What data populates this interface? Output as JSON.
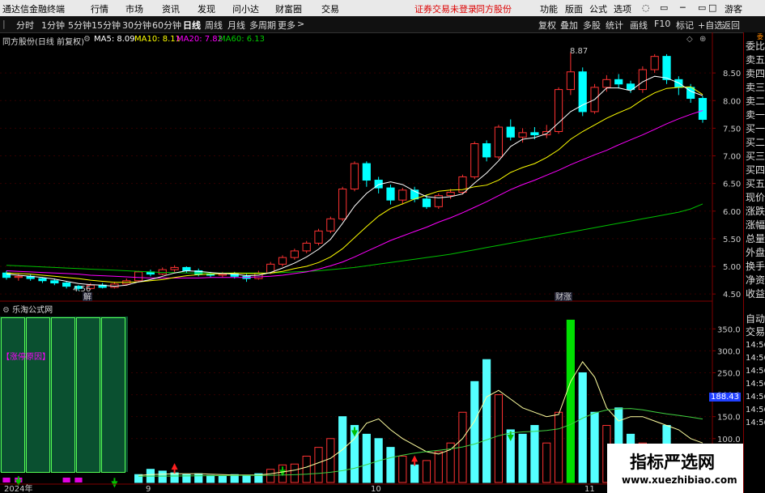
{
  "menubar": {
    "app_title": "通达信金融终端",
    "items": [
      "行情",
      "市场",
      "资讯",
      "发现",
      "问小达",
      "财富圈",
      "交易"
    ],
    "notice": "证券交易未登录",
    "stock": "同方股份",
    "right_items": [
      "功能",
      "版面",
      "公式",
      "选项"
    ],
    "guest": "游客"
  },
  "toolbar": {
    "periods": [
      "分时",
      "1分钟",
      "5分钟",
      "15分钟",
      "30分钟",
      "60分钟",
      "日线",
      "周线",
      "月线",
      "多周期",
      "更多"
    ],
    "active_period": "日线",
    "right_buttons": [
      "复权",
      "叠加",
      "多股",
      "统计",
      "画线",
      "F10",
      "标记",
      "+自选",
      "返回"
    ]
  },
  "infobar": {
    "title": "同方股份(日线 前复权)",
    "ma5": "MA5: 8.09",
    "ma10": "MA10: 8.11",
    "ma20": "MA20: 7.82",
    "ma60": "MA60: 6.13"
  },
  "lower_panel": {
    "title": "乐淘公式网",
    "label": "【涨停原因】"
  },
  "markers": {
    "high_label": "8.87",
    "low_label": "4.56",
    "tag_jie": "解",
    "tag_caizhang": "财涨"
  },
  "right_panel_items": [
    "委比",
    "卖五",
    "卖四",
    "卖三",
    "卖二",
    "卖一",
    "买一",
    "买二",
    "买三",
    "买四",
    "买五",
    "现价",
    "涨跌",
    "涨幅",
    "总量",
    "外盘",
    "换手",
    "净资",
    "收益",
    "自动",
    "交易",
    "14:56",
    "14:56",
    "14:56",
    "14:56",
    "14:56",
    "14:56",
    "14:56"
  ],
  "x_axis_labels": [
    "2024年",
    "9",
    "10",
    "11"
  ],
  "watermark": {
    "title": "指标严选网",
    "url": "www.xuezhibiao.com"
  },
  "colors": {
    "up": "#ff3232",
    "down": "#00ffff",
    "ma5": "#ffffff",
    "ma10": "#ffff00",
    "ma20": "#ff00ff",
    "ma60": "#00c000",
    "volume_up": "#ff3232",
    "volume_down": "#54ffff"
  },
  "chart_data": [
    {
      "type": "candlestick",
      "yaxis_ticks": [
        4.5,
        5.0,
        5.5,
        6.0,
        6.5,
        7.0,
        7.5,
        8.0,
        8.5
      ],
      "ylim": [
        4.4,
        9.0
      ],
      "candles": [
        [
          4.88,
          4.8,
          4.92,
          4.76
        ],
        [
          4.8,
          4.82,
          4.86,
          4.74
        ],
        [
          4.82,
          4.78,
          4.85,
          4.74
        ],
        [
          4.78,
          4.74,
          4.8,
          4.7
        ],
        [
          4.74,
          4.7,
          4.78,
          4.66
        ],
        [
          4.7,
          4.64,
          4.72,
          4.6
        ],
        [
          4.64,
          4.6,
          4.66,
          4.56
        ],
        [
          4.6,
          4.66,
          4.7,
          4.58
        ],
        [
          4.66,
          4.62,
          4.7,
          4.6
        ],
        [
          4.62,
          4.68,
          4.72,
          4.6
        ],
        [
          4.68,
          4.74,
          4.78,
          4.66
        ],
        [
          4.74,
          4.9,
          4.92,
          4.72
        ],
        [
          4.9,
          4.86,
          4.94,
          4.82
        ],
        [
          4.86,
          4.94,
          4.98,
          4.84
        ],
        [
          4.94,
          4.98,
          5.02,
          4.9
        ],
        [
          4.98,
          4.92,
          5.0,
          4.88
        ],
        [
          4.92,
          4.86,
          4.96,
          4.82
        ],
        [
          4.86,
          4.84,
          4.9,
          4.8
        ],
        [
          4.84,
          4.86,
          4.9,
          4.8
        ],
        [
          4.86,
          4.82,
          4.9,
          4.78
        ],
        [
          4.82,
          4.78,
          4.86,
          4.72
        ],
        [
          4.78,
          4.88,
          4.92,
          4.76
        ],
        [
          4.88,
          5.04,
          5.08,
          4.86
        ],
        [
          5.04,
          5.16,
          5.2,
          5.0
        ],
        [
          5.16,
          5.28,
          5.32,
          5.12
        ],
        [
          5.28,
          5.42,
          5.46,
          5.24
        ],
        [
          5.42,
          5.64,
          5.68,
          5.38
        ],
        [
          5.64,
          5.86,
          5.9,
          5.6
        ],
        [
          5.86,
          6.4,
          6.44,
          5.82
        ],
        [
          6.4,
          6.86,
          6.9,
          6.36
        ],
        [
          6.86,
          6.56,
          6.9,
          6.44
        ],
        [
          6.56,
          6.42,
          6.62,
          6.32
        ],
        [
          6.42,
          6.2,
          6.48,
          6.12
        ],
        [
          6.2,
          6.38,
          6.42,
          6.12
        ],
        [
          6.38,
          6.22,
          6.44,
          6.16
        ],
        [
          6.22,
          6.08,
          6.3,
          6.04
        ],
        [
          6.08,
          6.28,
          6.32,
          6.04
        ],
        [
          6.28,
          6.34,
          6.4,
          6.22
        ],
        [
          6.34,
          6.62,
          6.66,
          6.3
        ],
        [
          6.62,
          7.22,
          7.26,
          6.58
        ],
        [
          7.22,
          6.98,
          7.28,
          6.9
        ],
        [
          6.98,
          7.52,
          7.56,
          6.94
        ],
        [
          7.52,
          7.34,
          7.66,
          7.28
        ],
        [
          7.34,
          7.42,
          7.5,
          7.24
        ],
        [
          7.42,
          7.38,
          7.52,
          7.3
        ],
        [
          7.38,
          7.44,
          7.56,
          7.32
        ],
        [
          7.44,
          8.2,
          8.24,
          7.4
        ],
        [
          8.2,
          8.52,
          8.87,
          8.1
        ],
        [
          8.52,
          7.8,
          8.6,
          7.72
        ],
        [
          7.8,
          8.24,
          8.3,
          7.76
        ],
        [
          8.24,
          8.38,
          8.46,
          8.16
        ],
        [
          8.38,
          8.3,
          8.48,
          8.22
        ],
        [
          8.3,
          8.2,
          8.36,
          8.14
        ],
        [
          8.2,
          8.56,
          8.62,
          8.14
        ],
        [
          8.56,
          8.8,
          8.84,
          8.5
        ],
        [
          8.8,
          8.38,
          8.84,
          8.3
        ],
        [
          8.38,
          8.24,
          8.44,
          8.1
        ],
        [
          8.24,
          8.04,
          8.3,
          7.96
        ],
        [
          8.04,
          7.66,
          8.08,
          7.6
        ]
      ],
      "ma5": [
        4.86,
        4.84,
        4.82,
        4.8,
        4.77,
        4.73,
        4.69,
        4.67,
        4.66,
        4.64,
        4.66,
        4.72,
        4.76,
        4.82,
        4.88,
        4.92,
        4.91,
        4.89,
        4.87,
        4.86,
        4.83,
        4.84,
        4.89,
        4.97,
        5.06,
        5.17,
        5.31,
        5.49,
        5.78,
        6.09,
        6.32,
        6.48,
        6.53,
        6.48,
        6.36,
        6.26,
        6.24,
        6.26,
        6.31,
        6.51,
        6.69,
        6.91,
        7.17,
        7.3,
        7.33,
        7.4,
        7.6,
        7.8,
        7.92,
        8.02,
        8.23,
        8.23,
        8.18,
        8.34,
        8.44,
        8.41,
        8.32,
        8.17,
        8.09
      ],
      "ma10": [
        4.88,
        4.87,
        4.86,
        4.84,
        4.82,
        4.8,
        4.78,
        4.75,
        4.73,
        4.71,
        4.71,
        4.72,
        4.74,
        4.76,
        4.8,
        4.83,
        4.85,
        4.86,
        4.87,
        4.88,
        4.87,
        4.87,
        4.88,
        4.91,
        4.96,
        5.0,
        5.07,
        5.17,
        5.32,
        5.52,
        5.72,
        5.91,
        6.05,
        6.13,
        6.22,
        6.29,
        6.36,
        6.38,
        6.39,
        6.44,
        6.47,
        6.56,
        6.7,
        6.79,
        6.86,
        6.97,
        7.11,
        7.3,
        7.44,
        7.56,
        7.68,
        7.78,
        7.87,
        8.02,
        8.14,
        8.22,
        8.24,
        8.25,
        8.11
      ],
      "ma20": [
        4.92,
        4.91,
        4.9,
        4.89,
        4.88,
        4.87,
        4.86,
        4.84,
        4.83,
        4.82,
        4.81,
        4.8,
        4.79,
        4.79,
        4.79,
        4.79,
        4.79,
        4.8,
        4.8,
        4.8,
        4.8,
        4.81,
        4.82,
        4.84,
        4.87,
        4.9,
        4.95,
        5.01,
        5.08,
        5.17,
        5.27,
        5.37,
        5.47,
        5.55,
        5.63,
        5.71,
        5.8,
        5.88,
        5.97,
        6.07,
        6.17,
        6.28,
        6.39,
        6.48,
        6.56,
        6.65,
        6.74,
        6.84,
        6.93,
        7.02,
        7.1,
        7.2,
        7.29,
        7.38,
        7.48,
        7.58,
        7.67,
        7.75,
        7.82
      ],
      "ma60": [
        5.02,
        5.01,
        5.0,
        4.99,
        4.98,
        4.97,
        4.96,
        4.95,
        4.94,
        4.93,
        4.92,
        4.91,
        4.9,
        4.89,
        4.89,
        4.88,
        4.88,
        4.88,
        4.88,
        4.88,
        4.88,
        4.88,
        4.88,
        4.89,
        4.9,
        4.91,
        4.92,
        4.94,
        4.96,
        4.98,
        5.01,
        5.04,
        5.07,
        5.1,
        5.13,
        5.16,
        5.19,
        5.22,
        5.26,
        5.3,
        5.34,
        5.38,
        5.42,
        5.46,
        5.5,
        5.54,
        5.58,
        5.62,
        5.66,
        5.7,
        5.74,
        5.78,
        5.82,
        5.86,
        5.9,
        5.94,
        5.98,
        6.04,
        6.13
      ]
    },
    {
      "type": "bar",
      "title": "乐淘公式网",
      "yaxis_ticks": [
        100.0,
        150.0,
        200.0,
        250.0,
        300.0,
        350.0
      ],
      "ylim": [
        0,
        380
      ],
      "last_value": "188.43",
      "values": [
        14,
        18,
        12,
        10,
        8,
        16,
        22,
        18,
        20,
        14,
        12,
        18,
        30,
        26,
        22,
        18,
        20,
        16,
        14,
        18,
        16,
        20,
        30,
        40,
        42,
        60,
        80,
        100,
        150,
        130,
        110,
        100,
        80,
        60,
        40,
        50,
        70,
        90,
        160,
        230,
        280,
        200,
        120,
        110,
        130,
        90,
        160,
        370,
        250,
        160,
        130,
        170,
        110,
        90,
        80,
        130,
        80,
        60,
        40
      ],
      "up": [
        false,
        false,
        false,
        false,
        false,
        false,
        false,
        false,
        false,
        false,
        false,
        false,
        false,
        false,
        false,
        false,
        false,
        false,
        false,
        false,
        false,
        false,
        true,
        true,
        true,
        true,
        true,
        true,
        false,
        false,
        false,
        false,
        false,
        true,
        false,
        true,
        true,
        true,
        true,
        false,
        false,
        true,
        false,
        false,
        false,
        true,
        true,
        true,
        false,
        false,
        true,
        false,
        false,
        true,
        true,
        false,
        false,
        true,
        false
      ],
      "avg": [
        20,
        18,
        17,
        15,
        14,
        14,
        15,
        16,
        17,
        16,
        15,
        16,
        18,
        19,
        20,
        20,
        20,
        19,
        18,
        17,
        17,
        17,
        20,
        24,
        28,
        35,
        45,
        55,
        75,
        100,
        135,
        145,
        120,
        100,
        85,
        70,
        65,
        75,
        100,
        140,
        195,
        210,
        190,
        170,
        160,
        150,
        155,
        230,
        275,
        240,
        170,
        140,
        150,
        150,
        140,
        130,
        120,
        100,
        90
      ],
      "arrows_down": [
        1,
        9,
        23,
        29,
        42
      ],
      "arrows_up": [
        14,
        34
      ],
      "green_idx": [
        47
      ],
      "magenta_idx": [
        0,
        1,
        5,
        6
      ]
    }
  ]
}
